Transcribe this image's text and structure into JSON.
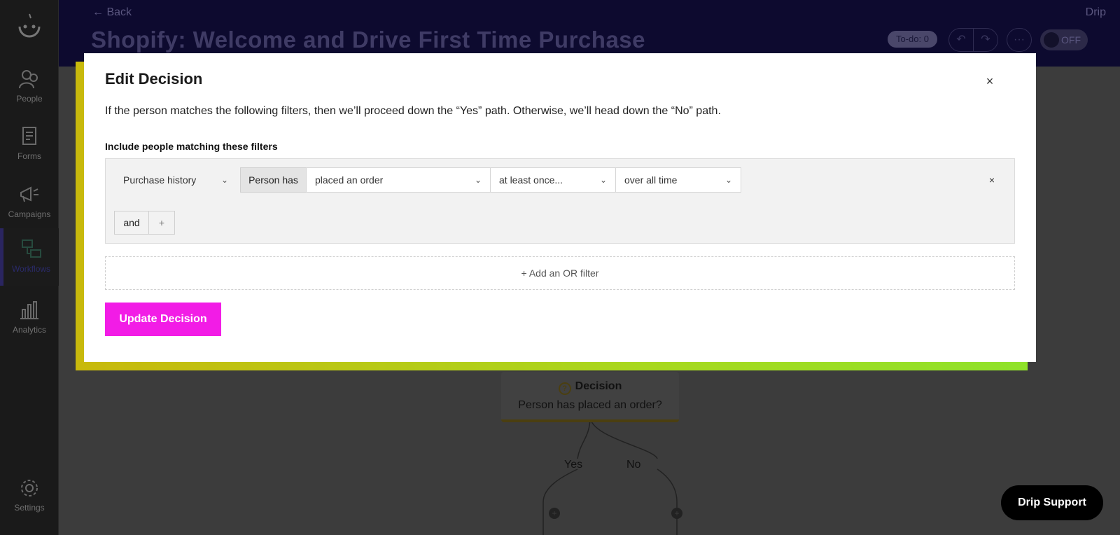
{
  "sidebar": {
    "logo_icon": "drip-smile-icon",
    "items": [
      {
        "label": "People",
        "icon": "people-icon"
      },
      {
        "label": "Forms",
        "icon": "form-icon"
      },
      {
        "label": "Campaigns",
        "icon": "megaphone-icon"
      },
      {
        "label": "Workflows",
        "icon": "workflow-icon",
        "active": true
      },
      {
        "label": "Analytics",
        "icon": "bar-chart-icon"
      },
      {
        "label": "Settings",
        "icon": "gear-icon"
      }
    ]
  },
  "header": {
    "back_label": "Back",
    "app_name": "Drip",
    "title": "Shopify: Welcome and Drive First Time Purchase",
    "todo_label": "To-do: 0",
    "toggle_label": "OFF"
  },
  "canvas": {
    "node_title": "Decision",
    "node_subtitle": "Person has placed an order?",
    "branch_yes": "Yes",
    "branch_no": "No"
  },
  "modal": {
    "title": "Edit Decision",
    "description": "If the person matches the following filters, then we’ll proceed down the “Yes” path. Otherwise, we’ll head down the “No” path.",
    "filters_label": "Include people matching these filters",
    "filter": {
      "category": "Purchase history",
      "subject": "Person has",
      "action": "placed an order",
      "frequency": "at least once...",
      "timeframe": "over all time"
    },
    "and_label": "and",
    "add_or_label": "Add an OR filter",
    "submit_label": "Update Decision"
  },
  "support_label": "Drip Support",
  "colors": {
    "header_bg": "#0d0a2f",
    "accent_pink": "#f21ce6",
    "accent_lime": "#8fe22a",
    "accent_yellow": "#c8b90c"
  }
}
